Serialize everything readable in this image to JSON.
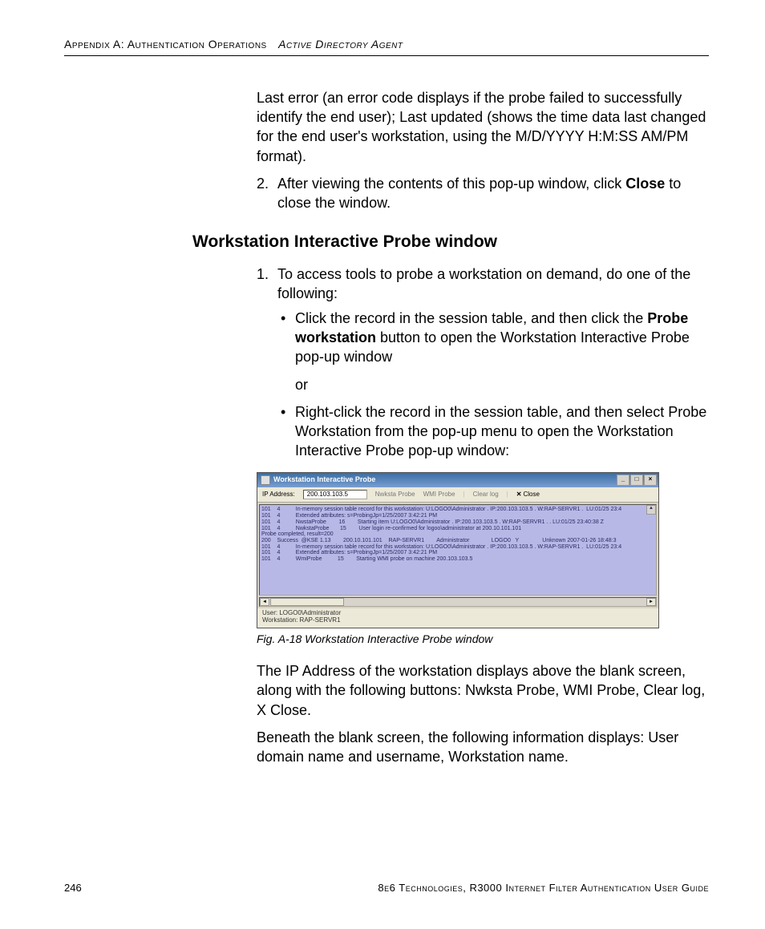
{
  "header": {
    "left": "Appendix A: Authentication Operations",
    "right": "Active Directory Agent"
  },
  "content": {
    "para_last_error": "Last error (an error code displays if the probe failed to successfully identify the end user); Last updated (shows the time data last changed for the end user's workstation, using the M/D/YYYY H:M:SS AM/PM format).",
    "numitem2_prefix": "After viewing the contents of this pop-up window, click ",
    "numitem2_bold": "Close",
    "numitem2_suffix": " to close the window.",
    "h3": "Workstation Interactive Probe window",
    "step1": "To access tools to probe a workstation on demand, do one of the following:",
    "bullet1_prefix": "Click the record in the session table, and then click the ",
    "bullet1_bold": "Probe workstation",
    "bullet1_suffix": " button to open the Workstation Interactive Probe pop-up window",
    "or": "or",
    "bullet2": "Right-click the record in the session table, and then select Probe Workstation from the pop-up menu to open the Workstation Interactive Probe pop-up window:",
    "caption": "Fig. A-18  Workstation Interactive Probe window",
    "para_after1": "The IP Address of the workstation displays above the blank screen, along with the following buttons: Nwksta Probe, WMI Probe, Clear log, X Close.",
    "para_after2": "Beneath the blank screen, the following information displays: User domain name and username, Workstation name."
  },
  "screenshot": {
    "title": "Workstation Interactive Probe",
    "toolbar": {
      "ip_label": "IP Address:",
      "ip_value": "200.103.103.5",
      "nwksta": "Nwksta Probe",
      "wmi": "WMI Probe",
      "clear": "Clear log",
      "close": "Close"
    },
    "log_lines": [
      "101    4          In-memory session table record for this workstation: U:LOGO0\\Administrator . IP:200.103.103.5 . W:RAP-SERVR1 .  LU:01/25 23:4",
      "101    4          Extended attributes: s=ProbingJp=1/25/2007 3:42:21 PM",
      "101    4          NwstaProbe        16        Starting item U:LOGO0\\Administrator . IP:200.103.103.5 . W:RAP-SERVR1 . . LU:01/25 23:40:38 Z",
      "101    4          NwkstaProbe       15        User login re-confirmed for logoo\\administrator at 200.10.101.101",
      "Probe completed, result=200",
      "200    Success  @KSE 1.13        200.10.101.101    RAP-SERVR1        Administrator              LOGO0   Y               Unknown 2007-01-26 18:48:3",
      "101    4          In-memory session table record for this workstation: U:LOGO0\\Administrator . IP:200.103.103.5 . W:RAP-SERVR1 .  LU:01/25 23:4",
      "101    4          Extended attributes: s=ProbingJp=1/25/2007 3:42:21 PM",
      "101    4          WmiProbe          15        Starting WMI probe on machine 200.103.103.5"
    ],
    "status_user": "User: LOGO0\\Administrator",
    "status_ws": "Workstation: RAP-SERVR1"
  },
  "footer": {
    "page": "246",
    "guide": "8e6 Technologies, R3000 Internet Filter Authentication User Guide"
  }
}
